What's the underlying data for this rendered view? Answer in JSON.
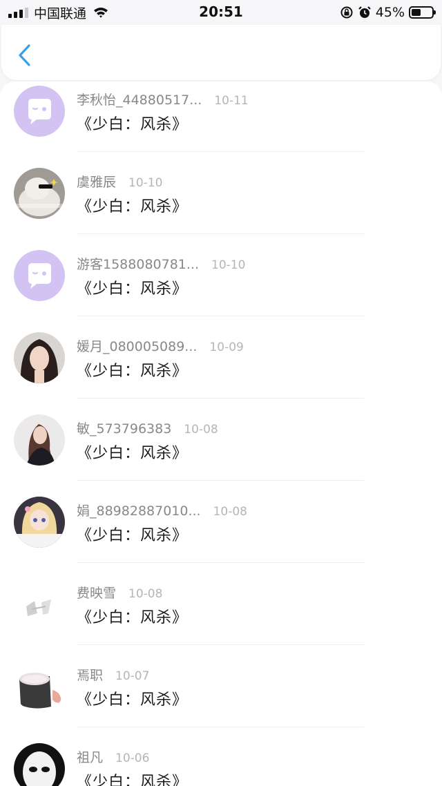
{
  "status_bar": {
    "carrier": "中国联通",
    "time": "20:51",
    "battery_percent": "45%",
    "battery_level": 0.45
  },
  "nav": {
    "back_icon": "chevron-left-icon",
    "accent_color": "#3a9ee8"
  },
  "items": [
    {
      "name": "李秋怡_44880517...",
      "date": "10-11",
      "message": "《少白：风杀》",
      "avatar": "default-avatar"
    },
    {
      "name": "虞雅辰",
      "date": "10-10",
      "message": "《少白：风杀》",
      "avatar": "photo"
    },
    {
      "name": "游客1588080781...",
      "date": "10-10",
      "message": "《少白：风杀》",
      "avatar": "default-avatar"
    },
    {
      "name": "媛月_080005089...",
      "date": "10-09",
      "message": "《少白：风杀》",
      "avatar": "photo"
    },
    {
      "name": "敏_573796383",
      "date": "10-08",
      "message": "《少白：风杀》",
      "avatar": "photo"
    },
    {
      "name": "娟_88982887010...",
      "date": "10-08",
      "message": "《少白：风杀》",
      "avatar": "photo"
    },
    {
      "name": "费映雪",
      "date": "10-08",
      "message": "《少白：风杀》",
      "avatar": "photo"
    },
    {
      "name": "焉职",
      "date": "10-07",
      "message": "《少白：风杀》",
      "avatar": "photo"
    },
    {
      "name": "祖凡",
      "date": "10-06",
      "message": "《少白：风杀》",
      "avatar": "photo"
    }
  ]
}
